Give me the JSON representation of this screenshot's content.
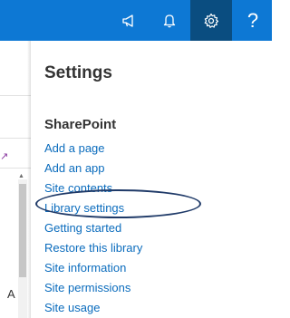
{
  "topbar": {
    "color": "#0d78d4",
    "active_color": "#0a4d80",
    "icons": [
      "megaphone-icon",
      "bell-icon",
      "gear-icon",
      "help-icon"
    ],
    "help_glyph": "?"
  },
  "background_page": {
    "partial_text": "A"
  },
  "settings": {
    "title": "Settings",
    "section": "SharePoint",
    "items": [
      "Add a page",
      "Add an app",
      "Site contents",
      "Library settings",
      "Getting started",
      "Restore this library",
      "Site information",
      "Site permissions",
      "Site usage"
    ],
    "highlighted_item": "Library settings"
  }
}
